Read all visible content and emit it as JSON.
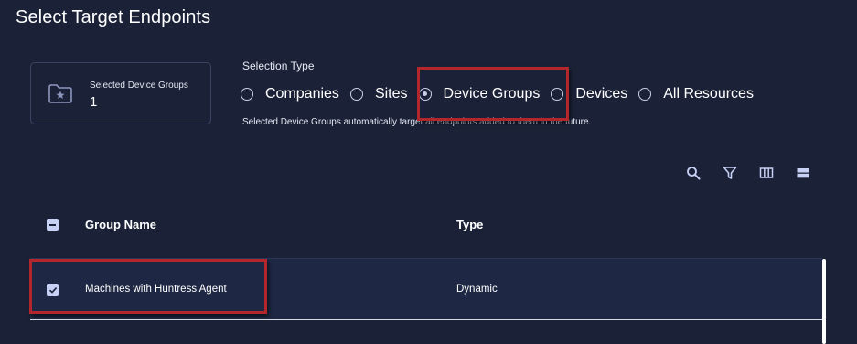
{
  "page": {
    "title": "Select Target Endpoints"
  },
  "summary": {
    "label": "Selected Device Groups",
    "count": "1",
    "icon": "folder-star-icon"
  },
  "selection": {
    "label": "Selection Type",
    "options": [
      {
        "label": "Companies",
        "checked": false
      },
      {
        "label": "Sites",
        "checked": false
      },
      {
        "label": "Device Groups",
        "checked": true
      },
      {
        "label": "Devices",
        "checked": false
      },
      {
        "label": "All Resources",
        "checked": false
      }
    ],
    "helper": "Selected Device Groups automatically target all endpoints added to them in the future."
  },
  "toolbar": {
    "icons": [
      "search-icon",
      "filter-icon",
      "columns-icon",
      "density-icon"
    ]
  },
  "table": {
    "headers": {
      "group_name": "Group Name",
      "type": "Type"
    },
    "rows": [
      {
        "name": "Machines with Huntress Agent",
        "type": "Dynamic",
        "selected": true
      }
    ]
  },
  "colors": {
    "background": "#1b2238",
    "row_background": "#1e2844",
    "highlight": "#b3262b",
    "accent": "#c7d0f5"
  }
}
